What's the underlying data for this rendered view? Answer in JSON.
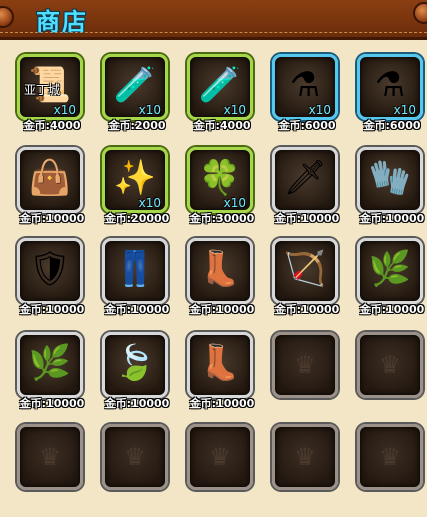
{
  "header": {
    "title": "商店"
  },
  "colors": {
    "header_bg": "#7a350e",
    "title": "#4fe0ff",
    "panel_bg": "#f3e6c6",
    "qty": "#6ee9ff"
  },
  "items": [
    {
      "icon": "scroll-icon",
      "glyph": "📜",
      "frame": "green",
      "overlay": "亚丁城",
      "qty": "x10",
      "price": "金币:4000"
    },
    {
      "icon": "red-potion-icon",
      "glyph": "🧪",
      "frame": "green",
      "overlay": "",
      "qty": "x10",
      "price": "金币:2000"
    },
    {
      "icon": "blue-potion-icon",
      "glyph": "🧪",
      "frame": "green",
      "overlay": "",
      "qty": "x10",
      "price": "金币:4000"
    },
    {
      "icon": "pink-potion-icon",
      "glyph": "⚗",
      "frame": "blue",
      "overlay": "",
      "qty": "x10",
      "price": "金币:6000"
    },
    {
      "icon": "blue-flask-icon",
      "glyph": "⚗",
      "frame": "blue",
      "overlay": "",
      "qty": "x10",
      "price": "金币:6000"
    },
    {
      "icon": "bag-icon",
      "glyph": "👜",
      "frame": "silver",
      "overlay": "",
      "qty": "",
      "price": "金币:10000"
    },
    {
      "icon": "glowing-orb-icon",
      "glyph": "✨",
      "frame": "green",
      "overlay": "",
      "qty": "x10",
      "price": "金币:20000"
    },
    {
      "icon": "green-gem-icon",
      "glyph": "🍀",
      "frame": "green",
      "overlay": "",
      "qty": "x10",
      "price": "金币:30000"
    },
    {
      "icon": "sword-icon",
      "glyph": "🗡",
      "frame": "silver",
      "overlay": "",
      "qty": "",
      "price": "金币:10000"
    },
    {
      "icon": "gloves-icon",
      "glyph": "🧤",
      "frame": "silver",
      "overlay": "",
      "qty": "",
      "price": "金币:10000"
    },
    {
      "icon": "armor-icon",
      "glyph": "🛡",
      "frame": "silver",
      "overlay": "",
      "qty": "",
      "price": "金币:10000"
    },
    {
      "icon": "pants-icon",
      "glyph": "👖",
      "frame": "silver",
      "overlay": "",
      "qty": "",
      "price": "金币:10000"
    },
    {
      "icon": "boots-icon",
      "glyph": "👢",
      "frame": "silver",
      "overlay": "",
      "qty": "",
      "price": "金币:10000"
    },
    {
      "icon": "bow-icon",
      "glyph": "🏹",
      "frame": "silver",
      "overlay": "",
      "qty": "",
      "price": "金币:10000"
    },
    {
      "icon": "leaf-gloves-icon",
      "glyph": "🌿",
      "frame": "silver",
      "overlay": "",
      "qty": "",
      "price": "金币:10000"
    },
    {
      "icon": "leaf-armor-icon",
      "glyph": "🌿",
      "frame": "silver",
      "overlay": "",
      "qty": "",
      "price": "金币:10000"
    },
    {
      "icon": "leaf-cloak-icon",
      "glyph": "🍃",
      "frame": "silver",
      "overlay": "",
      "qty": "",
      "price": "金币:10000"
    },
    {
      "icon": "leaf-boots-icon",
      "glyph": "👢",
      "frame": "silver",
      "overlay": "",
      "qty": "",
      "price": "金币:10000"
    },
    {
      "icon": "empty-slot-icon",
      "glyph": "",
      "frame": "empty",
      "overlay": "",
      "qty": "",
      "price": ""
    },
    {
      "icon": "empty-slot-icon",
      "glyph": "",
      "frame": "empty",
      "overlay": "",
      "qty": "",
      "price": ""
    },
    {
      "icon": "empty-slot-icon",
      "glyph": "",
      "frame": "empty",
      "overlay": "",
      "qty": "",
      "price": ""
    },
    {
      "icon": "empty-slot-icon",
      "glyph": "",
      "frame": "empty",
      "overlay": "",
      "qty": "",
      "price": ""
    },
    {
      "icon": "empty-slot-icon",
      "glyph": "",
      "frame": "empty",
      "overlay": "",
      "qty": "",
      "price": ""
    },
    {
      "icon": "empty-slot-icon",
      "glyph": "",
      "frame": "empty",
      "overlay": "",
      "qty": "",
      "price": ""
    },
    {
      "icon": "empty-slot-icon",
      "glyph": "",
      "frame": "empty",
      "overlay": "",
      "qty": "",
      "price": ""
    }
  ]
}
